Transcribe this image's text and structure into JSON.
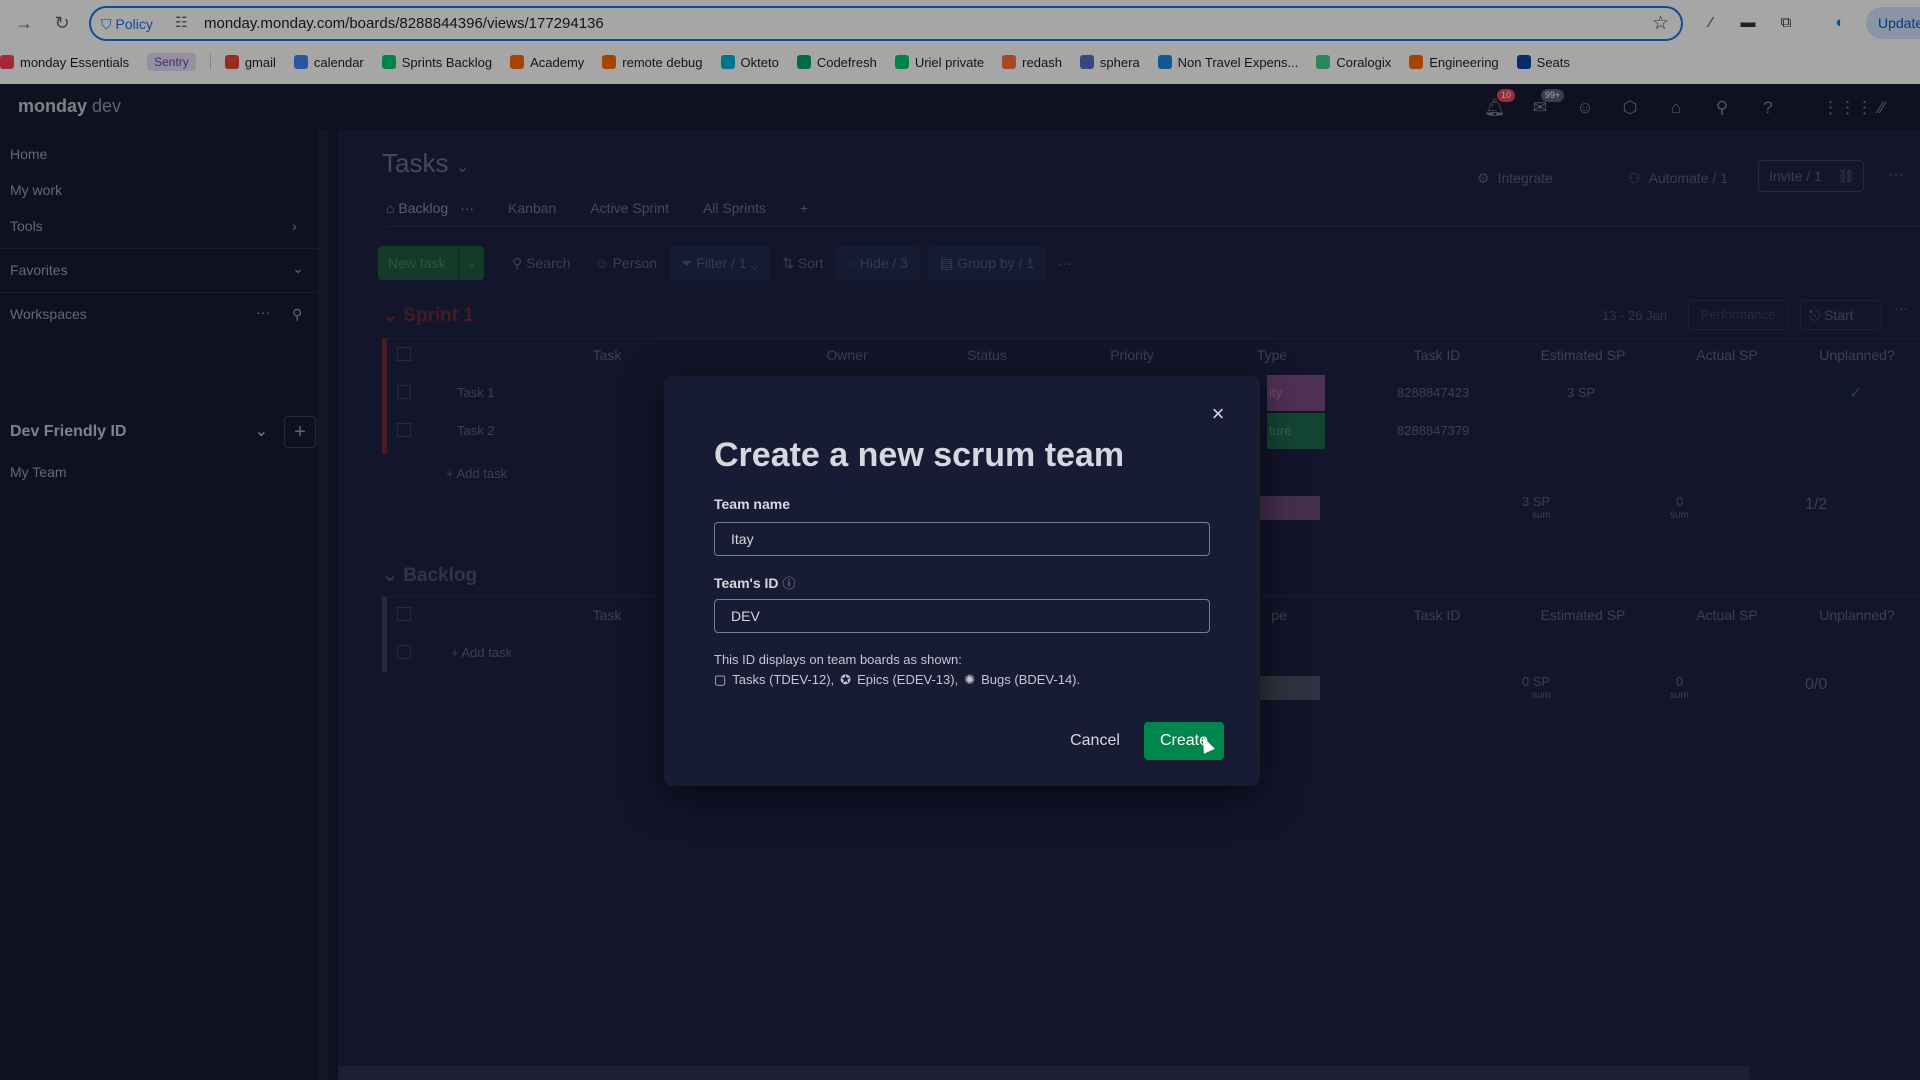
{
  "browser": {
    "policy_label": "Policy",
    "url": "monday.monday.com/boards/8288844396/views/177294136",
    "update_label": "Update",
    "bookmarks": [
      {
        "label": "monday Essentials",
        "color": "#ff3d57"
      },
      {
        "label": "Sentry",
        "color": "#6c4aa4"
      },
      {
        "label": "gmail",
        "color": "#ea4335"
      },
      {
        "label": "calendar",
        "color": "#4285f4"
      },
      {
        "label": "Sprints Backlog",
        "color": "#00c875"
      },
      {
        "label": "Academy",
        "color": "#ff6b00"
      },
      {
        "label": "remote debug",
        "color": "#ff6b00"
      },
      {
        "label": "Okteto",
        "color": "#00b4d8"
      },
      {
        "label": "Codefresh",
        "color": "#00a86b"
      },
      {
        "label": "Uriel private",
        "color": "#00c875"
      },
      {
        "label": "redash",
        "color": "#ff7043"
      },
      {
        "label": "sphera",
        "color": "#5c6bc0"
      },
      {
        "label": "Non Travel Expens...",
        "color": "#1e88e5"
      },
      {
        "label": "Coralogix",
        "color": "#3ecf8e"
      },
      {
        "label": "Engineering",
        "color": "#ff6b00"
      },
      {
        "label": "Seats",
        "color": "#0d47a1"
      }
    ]
  },
  "app": {
    "logo_main": "monday",
    "logo_sub": "dev",
    "notifications_count": "10",
    "inbox_count": "99+"
  },
  "sidebar": {
    "home": "Home",
    "my_work": "My work",
    "tools": "Tools",
    "favorites": "Favorites",
    "workspaces": "Workspaces",
    "workspace_name": "Dev Friendly ID",
    "team": "My Team"
  },
  "board": {
    "title": "Tasks",
    "views": [
      "Backlog",
      "Kanban",
      "Active Sprint",
      "All Sprints"
    ],
    "integrate": "Integrate",
    "automate": "Automate / 1",
    "invite": "Invite / 1",
    "toolbar": {
      "new_task": "New task",
      "search": "Search",
      "person": "Person",
      "filter": "Filter / 1",
      "sort": "Sort",
      "hide": "Hide / 3",
      "group_by": "Group by / 1"
    },
    "sprint_group": {
      "name": "Sprint 1",
      "dates": "13 - 26 Jan",
      "performance": "Performance",
      "start": "Start",
      "rows": [
        {
          "task": "Task 1",
          "type_partial": "ity",
          "task_id": "8288847423",
          "estimated": "3 SP",
          "unplanned": "✓"
        },
        {
          "task": "Task 2",
          "type_partial": "ture",
          "task_id": "8288847379",
          "estimated": "",
          "unplanned": ""
        }
      ],
      "add_task": "+ Add task",
      "sum_estimated": "3 SP",
      "sum_actual": "0",
      "sum_label": "sum",
      "unplanned_ratio": "1/2"
    },
    "backlog_group": {
      "name": "Backlog",
      "add_task": "+ Add task",
      "sum_estimated": "0 SP",
      "sum_actual": "0",
      "sum_label": "sum",
      "unplanned_ratio": "0/0"
    },
    "columns": [
      "Task",
      "Owner",
      "Status",
      "Priority",
      "Type",
      "Task ID",
      "Estimated SP",
      "Actual SP",
      "Unplanned?"
    ],
    "backlog_columns": [
      "Task",
      "pe",
      "Task ID",
      "Estimated SP",
      "Actual SP",
      "Unplanned?"
    ]
  },
  "dialog": {
    "title": "Create a new scrum team",
    "team_name_label": "Team name",
    "team_name_value": "Itay",
    "team_id_label": "Team's ID",
    "team_id_value": "DEV",
    "help_text": "This ID displays on team boards as shown:",
    "examples": [
      "Tasks (TDEV-12),",
      "Epics (EDEV-13),",
      "Bugs (BDEV-14)."
    ],
    "cancel": "Cancel",
    "create": "Create"
  }
}
